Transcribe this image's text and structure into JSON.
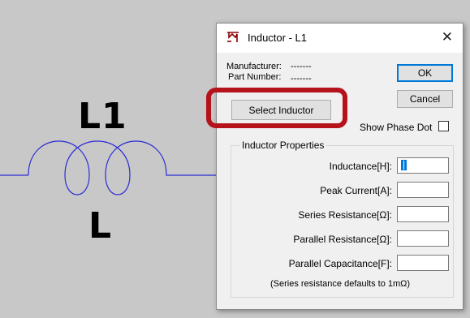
{
  "schematic": {
    "ref_designator": "L1",
    "value_label": "L",
    "wire_color": "#2b2bd6"
  },
  "dialog": {
    "title": "Inductor - L1",
    "close_glyph": "✕",
    "manufacturer_label": "Manufacturer:",
    "manufacturer_value": "-------",
    "part_number_label": "Part Number:",
    "part_number_value": "-------",
    "ok_label": "OK",
    "cancel_label": "Cancel",
    "select_label": "Select Inductor",
    "show_phase_dot_label": "Show Phase Dot",
    "show_phase_dot_checked": false,
    "group_title": "Inductor Properties",
    "fields": [
      {
        "label": "Inductance[H]:",
        "value": ""
      },
      {
        "label": "Peak Current[A]:",
        "value": ""
      },
      {
        "label": "Series Resistance[Ω]:",
        "value": ""
      },
      {
        "label": "Parallel Resistance[Ω]:",
        "value": ""
      },
      {
        "label": "Parallel Capacitance[F]:",
        "value": ""
      }
    ],
    "footnote": "(Series resistance defaults to 1mΩ)",
    "highlight_color": "#b5121b"
  }
}
